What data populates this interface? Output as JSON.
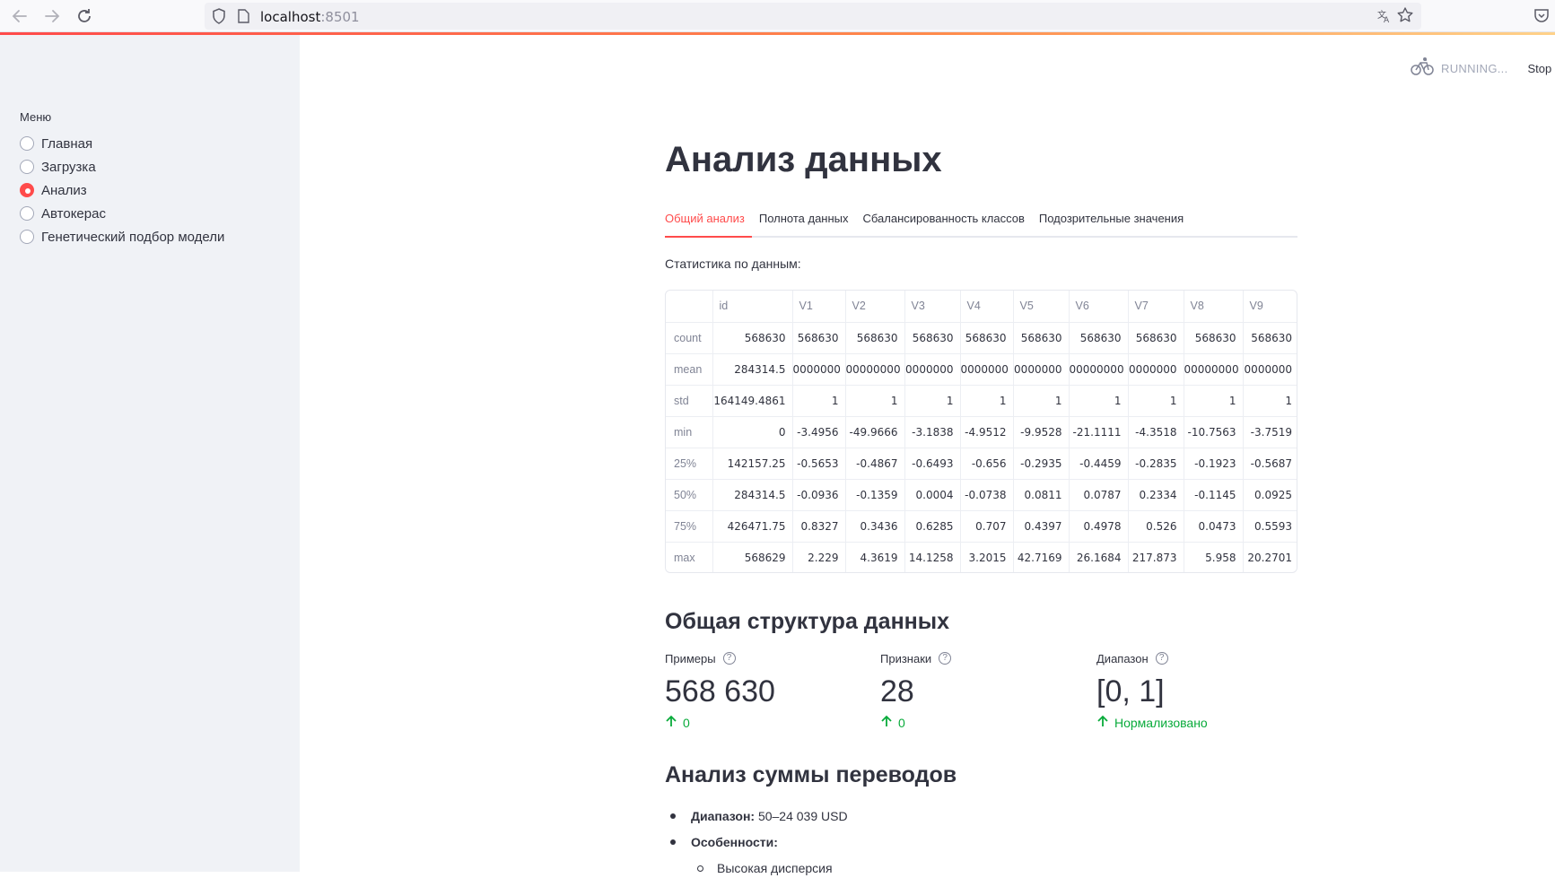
{
  "browser": {
    "url_host": "localhost",
    "url_port": ":8501"
  },
  "sidebar": {
    "menu_title": "Меню",
    "items": [
      {
        "label": "Главная",
        "checked": false
      },
      {
        "label": "Загрузка",
        "checked": false
      },
      {
        "label": "Анализ",
        "checked": true
      },
      {
        "label": "Автокерас",
        "checked": false
      },
      {
        "label": "Генетический подбор модели",
        "checked": false
      }
    ]
  },
  "status": {
    "running": "RUNNING...",
    "stop": "Stop"
  },
  "main": {
    "title": "Анализ данных",
    "tabs": [
      {
        "label": "Общий анализ",
        "active": true
      },
      {
        "label": "Полнота данных",
        "active": false
      },
      {
        "label": "Сбалансированность классов",
        "active": false
      },
      {
        "label": "Подозрительные значения",
        "active": false
      }
    ],
    "stats_caption": "Статистика по данным:",
    "table": {
      "columns": [
        "",
        "id",
        "V1",
        "V2",
        "V3",
        "V4",
        "V5",
        "V6",
        "V7",
        "V8",
        "V9"
      ],
      "rows": [
        [
          "count",
          "568630",
          "568630",
          "568630",
          "568630",
          "568630",
          "568630",
          "568630",
          "568630",
          "568630",
          "568630"
        ],
        [
          "mean",
          "284314.5",
          "0000000",
          "00000000",
          "0000000",
          "0000000",
          "0000000",
          "00000000",
          "0000000",
          "00000000",
          "0000000"
        ],
        [
          "std",
          "164149.4861",
          "1",
          "1",
          "1",
          "1",
          "1",
          "1",
          "1",
          "1",
          "1"
        ],
        [
          "min",
          "0",
          "-3.4956",
          "-49.9666",
          "-3.1838",
          "-4.9512",
          "-9.9528",
          "-21.1111",
          "-4.3518",
          "-10.7563",
          "-3.7519"
        ],
        [
          "25%",
          "142157.25",
          "-0.5653",
          "-0.4867",
          "-0.6493",
          "-0.656",
          "-0.2935",
          "-0.4459",
          "-0.2835",
          "-0.1923",
          "-0.5687"
        ],
        [
          "50%",
          "284314.5",
          "-0.0936",
          "-0.1359",
          "0.0004",
          "-0.0738",
          "0.0811",
          "0.0787",
          "0.2334",
          "-0.1145",
          "0.0925"
        ],
        [
          "75%",
          "426471.75",
          "0.8327",
          "0.3436",
          "0.6285",
          "0.707",
          "0.4397",
          "0.4978",
          "0.526",
          "0.0473",
          "0.5593"
        ],
        [
          "max",
          "568629",
          "2.229",
          "4.3619",
          "14.1258",
          "3.2015",
          "42.7169",
          "26.1684",
          "217.873",
          "5.958",
          "20.2701"
        ]
      ]
    },
    "structure_title": "Общая структура данных",
    "metrics": [
      {
        "label": "Примеры",
        "value": "568 630",
        "delta": "0"
      },
      {
        "label": "Признаки",
        "value": "28",
        "delta": "0"
      },
      {
        "label": "Диапазон",
        "value": "[0, 1]",
        "delta": "Нормализовано"
      }
    ],
    "amount_title": "Анализ суммы переводов",
    "bullets": [
      {
        "key": "Диапазон:",
        "text": " 50–24 039 USD"
      },
      {
        "key": "Особенности:",
        "text": ""
      }
    ],
    "sub_bullets": [
      "Высокая дисперсия"
    ]
  },
  "colors": {
    "accent": "#ff4b4b",
    "positive": "#09ab3b",
    "sidebar_bg": "#f0f2f6"
  }
}
